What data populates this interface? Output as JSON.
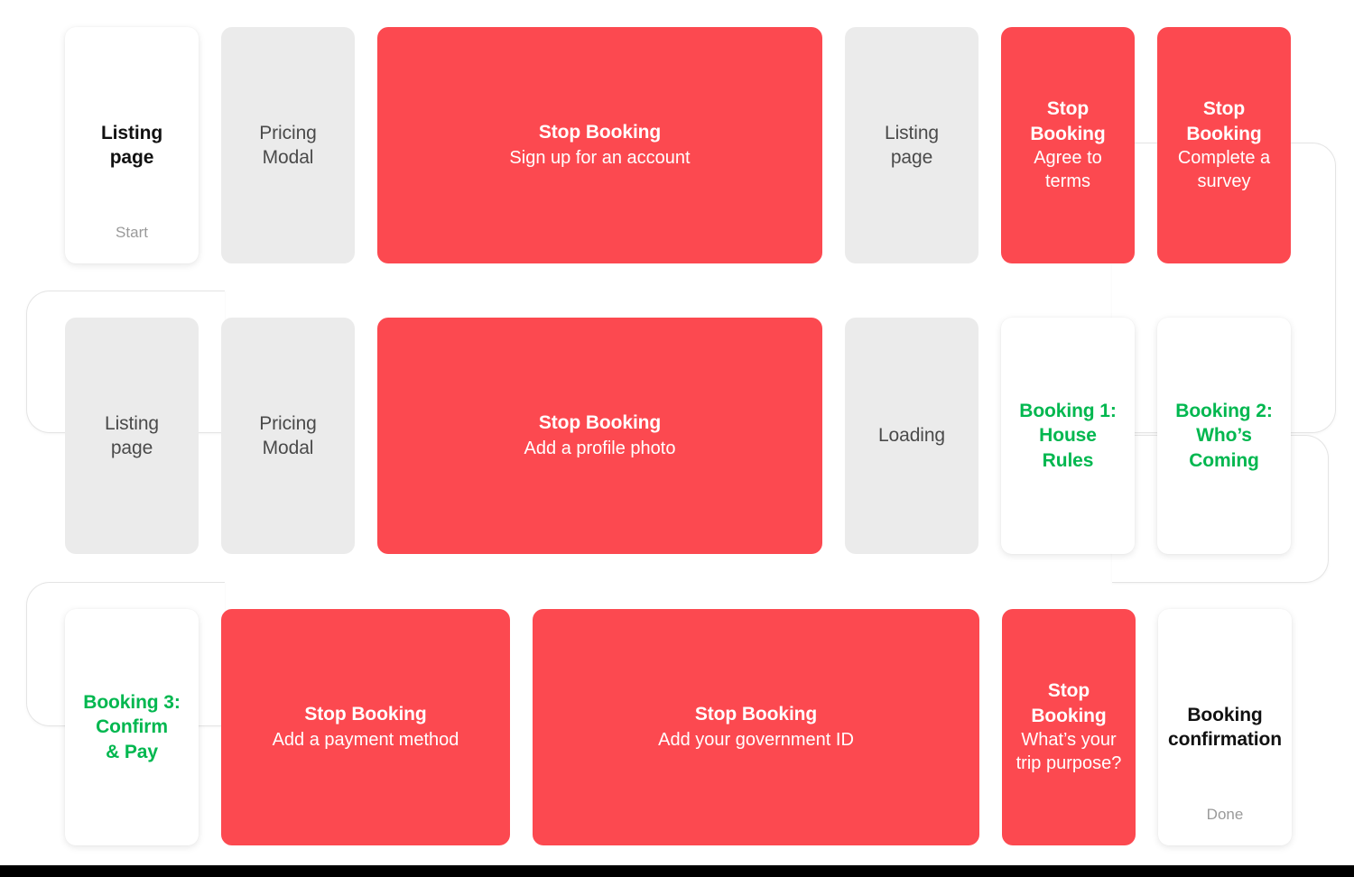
{
  "theme": {
    "red": "#fc4950",
    "grey": "#ebebeb",
    "green": "#00b74f",
    "white": "#ffffff",
    "black": "#000000",
    "muted_text": "#9a9a9a"
  },
  "flow": {
    "rows": [
      {
        "cards": [
          {
            "style": "white",
            "width": "narrow",
            "title": "Listing\npage",
            "title_line1": "Listing",
            "title_line2": "page",
            "sub": "",
            "footnote": "Start",
            "tone": "dark"
          },
          {
            "style": "grey",
            "width": "narrow",
            "title_line1": "Pricing",
            "title_line2": "Modal",
            "sub": "",
            "footnote": "",
            "tone": "muted"
          },
          {
            "style": "red",
            "width": "wide1",
            "title_line1": "Stop Booking",
            "title_line2": "",
            "sub": "Sign up for an account",
            "footnote": "",
            "tone": "onred"
          },
          {
            "style": "grey",
            "width": "narrow",
            "title_line1": "Listing",
            "title_line2": "page",
            "sub": "",
            "footnote": "",
            "tone": "muted"
          },
          {
            "style": "red",
            "width": "narrow",
            "title_line1": "Stop Booking",
            "title_line2": "",
            "sub": "Agree to terms",
            "footnote": "",
            "tone": "onred"
          },
          {
            "style": "red",
            "width": "narrow",
            "title_line1": "Stop Booking",
            "title_line2": "",
            "sub": "Complete a survey",
            "footnote": "",
            "tone": "onred"
          }
        ]
      },
      {
        "cards": [
          {
            "style": "grey",
            "width": "narrow",
            "title_line1": "Listing",
            "title_line2": "page",
            "sub": "",
            "footnote": "",
            "tone": "muted"
          },
          {
            "style": "grey",
            "width": "narrow",
            "title_line1": "Pricing",
            "title_line2": "Modal",
            "sub": "",
            "footnote": "",
            "tone": "muted"
          },
          {
            "style": "red",
            "width": "wide1",
            "title_line1": "Stop Booking",
            "title_line2": "",
            "sub": "Add a profile photo",
            "footnote": "",
            "tone": "onred"
          },
          {
            "style": "grey",
            "width": "narrow",
            "title_line1": "Loading",
            "title_line2": "",
            "sub": "",
            "footnote": "",
            "tone": "muted"
          },
          {
            "style": "white",
            "width": "narrow",
            "title_line1": "Booking 1:",
            "title_line2": "House Rules",
            "sub": "",
            "footnote": "",
            "tone": "green"
          },
          {
            "style": "white",
            "width": "narrow",
            "title_line1": "Booking 2:",
            "title_line2": "Who’s Coming",
            "sub": "",
            "footnote": "",
            "tone": "green"
          }
        ]
      },
      {
        "cards": [
          {
            "style": "white",
            "width": "narrow",
            "title_line1": "Booking 3:",
            "title_line2": "Confirm",
            "title_line3": "& Pay",
            "sub": "",
            "footnote": "",
            "tone": "green"
          },
          {
            "style": "red",
            "width": "wide2",
            "title_line1": "Stop Booking",
            "title_line2": "",
            "sub": "Add a payment method",
            "footnote": "",
            "tone": "onred"
          },
          {
            "style": "red",
            "width": "wide3",
            "title_line1": "Stop Booking",
            "title_line2": "",
            "sub": "Add your government ID",
            "footnote": "",
            "tone": "onred"
          },
          {
            "style": "red",
            "width": "narrow",
            "title_line1": "Stop Booking",
            "title_line2": "",
            "sub": "What’s your trip purpose?",
            "footnote": "",
            "tone": "onred"
          },
          {
            "style": "white",
            "width": "narrow",
            "title_line1": "Booking",
            "title_line2": "confirmation",
            "sub": "",
            "footnote": "Done",
            "tone": "dark"
          }
        ]
      }
    ]
  }
}
